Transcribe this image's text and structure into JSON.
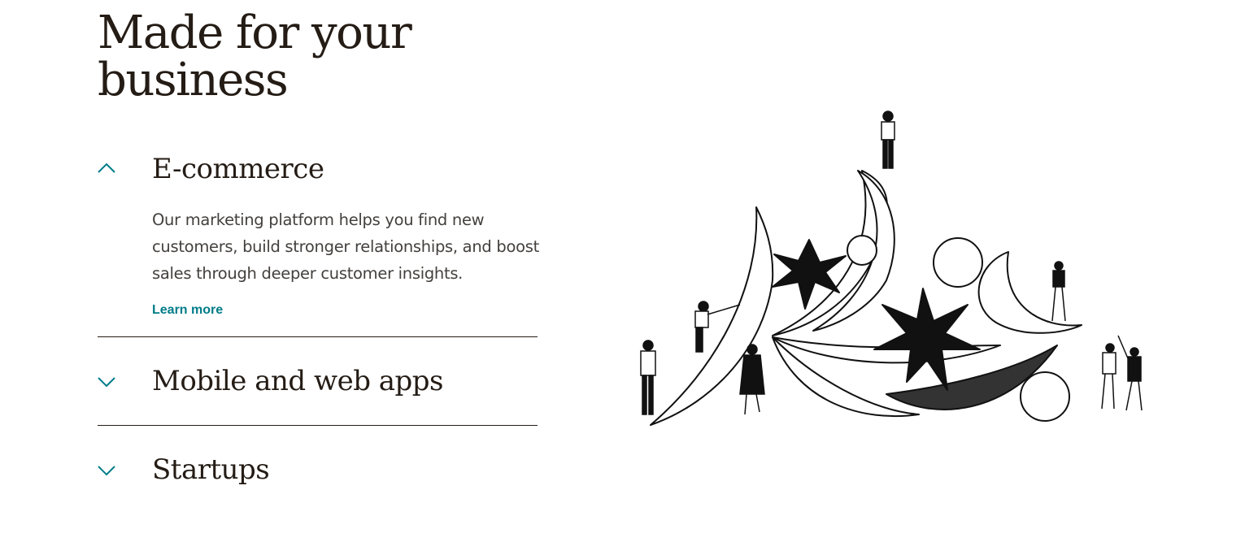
{
  "headline": "Made for your business",
  "accordion": {
    "items": [
      {
        "title": "E-commerce",
        "expanded": true,
        "description": "Our marketing platform helps you find new customers, build stronger relationships, and boost sales through deeper customer insights.",
        "link_label": "Learn more"
      },
      {
        "title": "Mobile and web apps",
        "expanded": false
      },
      {
        "title": "Startups",
        "expanded": false
      }
    ]
  },
  "colors": {
    "accent": "#007c89",
    "text": "#241c15",
    "body_text": "#43403d"
  },
  "icons": {
    "expanded": "chevron-up-icon",
    "collapsed": "chevron-down-icon"
  }
}
